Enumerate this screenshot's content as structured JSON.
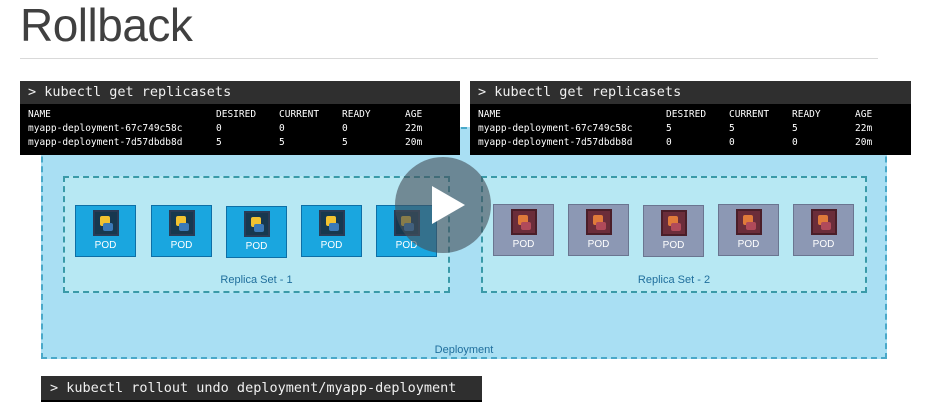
{
  "slide": {
    "title": "Rollback"
  },
  "terminal_left": {
    "command": "> kubectl get replicasets",
    "columns": [
      "NAME",
      "DESIRED",
      "CURRENT",
      "READY",
      "AGE"
    ],
    "rows": [
      [
        "myapp-deployment-67c749c58c",
        "0",
        "0",
        "0",
        "22m"
      ],
      [
        "myapp-deployment-7d57dbdb8d",
        "5",
        "5",
        "5",
        "20m"
      ]
    ]
  },
  "terminal_right": {
    "command": "> kubectl get replicasets",
    "columns": [
      "NAME",
      "DESIRED",
      "CURRENT",
      "READY",
      "AGE"
    ],
    "rows": [
      [
        "myapp-deployment-67c749c58c",
        "5",
        "5",
        "5",
        "22m"
      ],
      [
        "myapp-deployment-7d57dbdb8d",
        "0",
        "0",
        "0",
        "20m"
      ]
    ]
  },
  "deployment": {
    "label": "Deployment"
  },
  "replica_set_1": {
    "label": "Replica Set - 1",
    "pods": [
      "POD",
      "POD",
      "POD",
      "POD",
      "POD"
    ]
  },
  "replica_set_2": {
    "label": "Replica Set - 2",
    "pods": [
      "POD",
      "POD",
      "POD",
      "POD",
      "POD"
    ]
  },
  "command_bar": {
    "text": "> kubectl rollout undo deployment/myapp-deployment"
  },
  "colors": {
    "deployment_bg": "#a9dff3",
    "active_pod": "#1aa6df",
    "old_pod": "#8c98b4",
    "terminal_bg": "#000000"
  },
  "icons": {
    "play": "play-icon",
    "pod_logo": "python-icon"
  }
}
